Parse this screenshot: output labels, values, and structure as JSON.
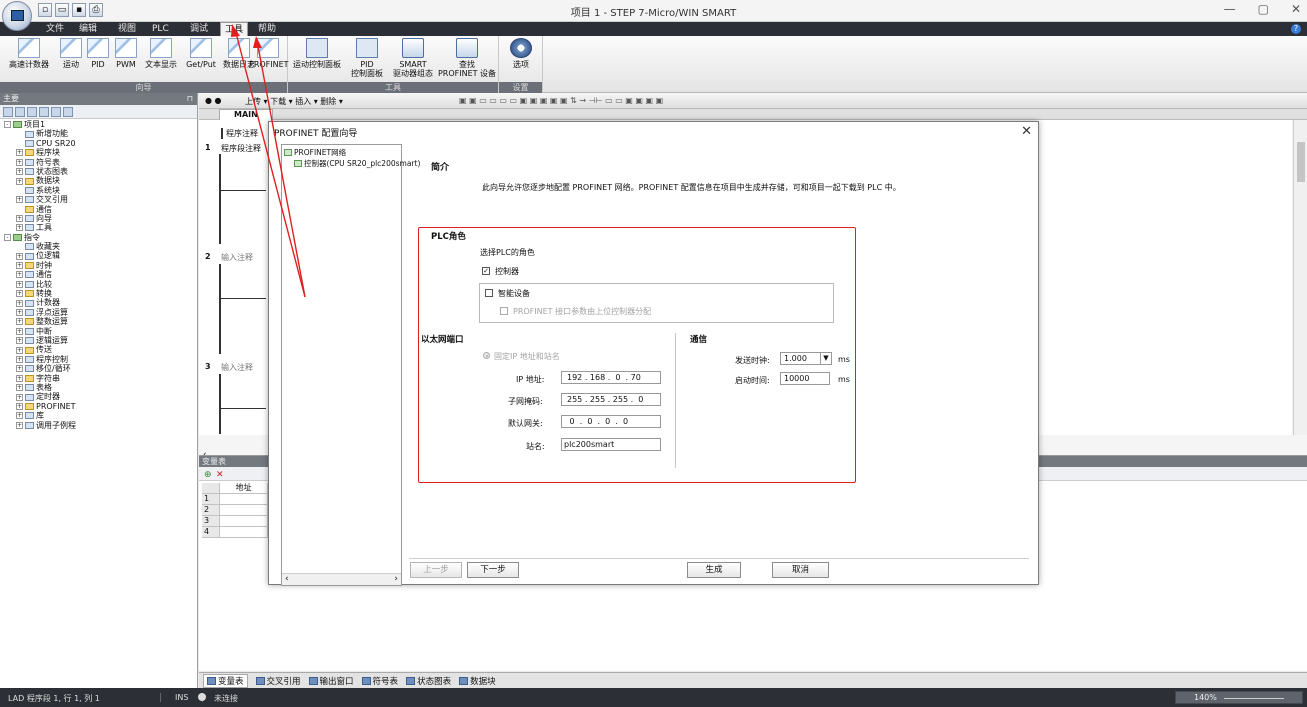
{
  "window": {
    "title": "项目 1 - STEP 7-Micro/WIN SMART",
    "controls": [
      "—",
      "▢",
      "✕"
    ]
  },
  "menu": {
    "items": [
      "文件",
      "编辑",
      "视图",
      "PLC",
      "调试",
      "工具",
      "帮助"
    ],
    "active": "工具"
  },
  "ribbon": {
    "wizard_buttons": [
      "高速计数器",
      "运动",
      "PID",
      "PWM",
      "文本显示",
      "Get/Put",
      "数据日志",
      "PROFINET"
    ],
    "wizard_group": "向导",
    "tool_buttons": [
      "运动控制面板",
      "PID\n控制面板",
      "SMART\n驱动器组态",
      "查找\nPROFINET 设备"
    ],
    "tool_group": "工具",
    "settings_buttons": [
      "选项"
    ],
    "settings_group": "设置"
  },
  "left_panel": {
    "title": "主要",
    "tree": [
      {
        "label": "项目1",
        "level": 0,
        "exp": "-"
      },
      {
        "label": "新增功能",
        "level": 1,
        "exp": ""
      },
      {
        "label": "CPU SR20",
        "level": 1,
        "exp": ""
      },
      {
        "label": "程序块",
        "level": 1,
        "exp": "+"
      },
      {
        "label": "符号表",
        "level": 1,
        "exp": "+"
      },
      {
        "label": "状态图表",
        "level": 1,
        "exp": "+"
      },
      {
        "label": "数据块",
        "level": 1,
        "exp": "+"
      },
      {
        "label": "系统块",
        "level": 1,
        "exp": ""
      },
      {
        "label": "交叉引用",
        "level": 1,
        "exp": "+"
      },
      {
        "label": "通信",
        "level": 1,
        "exp": ""
      },
      {
        "label": "向导",
        "level": 1,
        "exp": "+"
      },
      {
        "label": "工具",
        "level": 1,
        "exp": "+"
      },
      {
        "label": "指令",
        "level": 0,
        "exp": "-"
      },
      {
        "label": "收藏夹",
        "level": 1,
        "exp": ""
      },
      {
        "label": "位逻辑",
        "level": 1,
        "exp": "+"
      },
      {
        "label": "时钟",
        "level": 1,
        "exp": "+"
      },
      {
        "label": "通信",
        "level": 1,
        "exp": "+"
      },
      {
        "label": "比较",
        "level": 1,
        "exp": "+"
      },
      {
        "label": "转换",
        "level": 1,
        "exp": "+"
      },
      {
        "label": "计数器",
        "level": 1,
        "exp": "+"
      },
      {
        "label": "浮点运算",
        "level": 1,
        "exp": "+"
      },
      {
        "label": "整数运算",
        "level": 1,
        "exp": "+"
      },
      {
        "label": "中断",
        "level": 1,
        "exp": "+"
      },
      {
        "label": "逻辑运算",
        "level": 1,
        "exp": "+"
      },
      {
        "label": "传送",
        "level": 1,
        "exp": "+"
      },
      {
        "label": "程序控制",
        "level": 1,
        "exp": "+"
      },
      {
        "label": "移位/循环",
        "level": 1,
        "exp": "+"
      },
      {
        "label": "字符串",
        "level": 1,
        "exp": "+"
      },
      {
        "label": "表格",
        "level": 1,
        "exp": "+"
      },
      {
        "label": "定时器",
        "level": 1,
        "exp": "+"
      },
      {
        "label": "PROFINET",
        "level": 1,
        "exp": "+"
      },
      {
        "label": "库",
        "level": 1,
        "exp": "+"
      },
      {
        "label": "调用子例程",
        "level": 1,
        "exp": "+"
      }
    ]
  },
  "editor": {
    "toolbar_text": "上传 ▾  下载 ▾  插入 ▾  删除 ▾",
    "tab": "MAIN",
    "program_comment": "程序注释",
    "networks": [
      {
        "num": "1",
        "comment": "程序段注释"
      },
      {
        "num": "2",
        "comment": "输入注释"
      },
      {
        "num": "3",
        "comment": "输入注释"
      }
    ]
  },
  "var_table": {
    "title": "变量表",
    "col_header": "地址",
    "rows": [
      "1",
      "2",
      "3",
      "4"
    ]
  },
  "bottom_tabs": [
    "变量表",
    "交叉引用",
    "输出窗口",
    "符号表",
    "状态图表",
    "数据块"
  ],
  "status_bar": {
    "position": "LAD 程序段 1, 行 1, 列 1",
    "mode": "INS",
    "connection": "未连接",
    "zoom": "140%"
  },
  "dialog": {
    "title": "PROFINET 配置向导",
    "tree_root": "PROFINET网络",
    "tree_child": "控制器(CPU SR20_plc200smart)",
    "intro_heading": "简介",
    "intro_text": "此向导允许您逐步地配置 PROFINET 网络。PROFINET 配置信息在项目中生成并存储，可和项目一起下载到 PLC 中。",
    "plc_role_heading": "PLC角色",
    "plc_role_prompt": "选择PLC的角色",
    "controller_label": "控制器",
    "controller_checked": true,
    "smart_device_label": "智能设备",
    "smart_device_checked": false,
    "smart_device_sub": "PROFINET 接口参数由上位控制器分配",
    "ethernet_heading": "以太网端口",
    "fixed_ip_label": "固定IP 地址和站名",
    "ip_label": "IP 地址:",
    "ip_value": "192 . 168 .  0  . 70",
    "subnet_label": "子网掩码:",
    "subnet_value": "255 . 255 . 255 .  0",
    "gateway_label": "默认网关:",
    "gateway_value": " 0  .  0  .  0  .  0",
    "station_label": "站名:",
    "station_value": "plc200smart",
    "comm_heading": "通信",
    "send_clock_label": "发送时钟:",
    "send_clock_value": "1.000",
    "send_clock_unit": "ms",
    "startup_label": "启动时间:",
    "startup_value": "10000",
    "startup_unit": "ms",
    "buttons": {
      "prev": "上一步",
      "next": "下一步",
      "generate": "生成",
      "cancel": "取消"
    }
  },
  "annotation_color": "#e02020"
}
